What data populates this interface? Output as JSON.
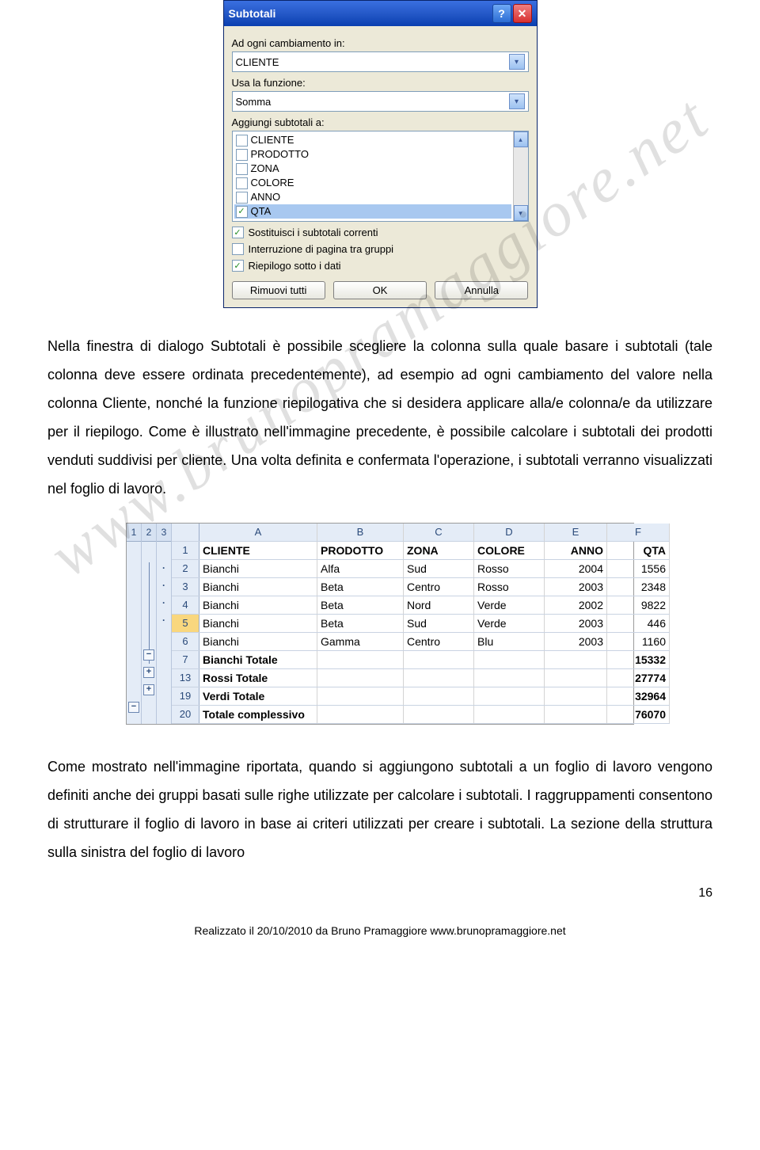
{
  "watermark": "www.brunopramaggiore.net",
  "dialog": {
    "title": "Subtotali",
    "label_change": "Ad ogni cambiamento in:",
    "select_change": "CLIENTE",
    "label_func": "Usa la funzione:",
    "select_func": "Somma",
    "label_add": "Aggiungi subtotali a:",
    "items": [
      {
        "label": "CLIENTE",
        "checked": false
      },
      {
        "label": "PRODOTTO",
        "checked": false
      },
      {
        "label": "ZONA",
        "checked": false
      },
      {
        "label": "COLORE",
        "checked": false
      },
      {
        "label": "ANNO",
        "checked": false
      },
      {
        "label": "QTA",
        "checked": true,
        "selected": true
      }
    ],
    "opt_replace": "Sostituisci i subtotali correnti",
    "opt_replace_checked": true,
    "opt_pagebreak": "Interruzione di pagina tra gruppi",
    "opt_pagebreak_checked": false,
    "opt_summary": "Riepilogo sotto i dati",
    "opt_summary_checked": true,
    "btn_remove": "Rimuovi tutti",
    "btn_ok": "OK",
    "btn_cancel": "Annulla"
  },
  "para1": "Nella finestra di dialogo Subtotali è possibile scegliere la colonna sulla quale basare i subtotali (tale colonna deve essere ordinata precedentemente), ad esempio ad ogni cambiamento del valore nella colonna Cliente, nonché la funzione riepilogativa che si desidera applicare alla/e colonna/e da utilizzare per il riepilogo. Come è illustrato nell'immagine precedente, è possibile calcolare i subtotali dei prodotti venduti suddivisi per cliente. Una volta definita e confermata l'operazione, i subtotali verranno visualizzati nel foglio di lavoro.",
  "sheet": {
    "outline_levels": [
      "1",
      "2",
      "3"
    ],
    "cols": [
      "A",
      "B",
      "C",
      "D",
      "E",
      "F"
    ],
    "rows": [
      {
        "n": "1",
        "bold": true,
        "c": [
          "CLIENTE",
          "PRODOTTO",
          "ZONA",
          "COLORE",
          "ANNO",
          "QTA"
        ]
      },
      {
        "n": "2",
        "c": [
          "Bianchi",
          "Alfa",
          "Sud",
          "Rosso",
          "2004",
          "1556"
        ]
      },
      {
        "n": "3",
        "c": [
          "Bianchi",
          "Beta",
          "Centro",
          "Rosso",
          "2003",
          "2348"
        ]
      },
      {
        "n": "4",
        "c": [
          "Bianchi",
          "Beta",
          "Nord",
          "Verde",
          "2002",
          "9822"
        ]
      },
      {
        "n": "5",
        "sel": true,
        "c": [
          "Bianchi",
          "Beta",
          "Sud",
          "Verde",
          "2003",
          "446"
        ]
      },
      {
        "n": "6",
        "c": [
          "Bianchi",
          "Gamma",
          "Centro",
          "Blu",
          "2003",
          "1160"
        ]
      },
      {
        "n": "7",
        "bold": true,
        "c": [
          "Bianchi Totale",
          "",
          "",
          "",
          "",
          "15332"
        ]
      },
      {
        "n": "13",
        "bold": true,
        "c": [
          "Rossi Totale",
          "",
          "",
          "",
          "",
          "27774"
        ]
      },
      {
        "n": "19",
        "bold": true,
        "c": [
          "Verdi Totale",
          "",
          "",
          "",
          "",
          "32964"
        ]
      },
      {
        "n": "20",
        "bold": true,
        "c": [
          "Totale complessivo",
          "",
          "",
          "",
          "",
          "76070"
        ]
      }
    ]
  },
  "para2": "Come mostrato nell'immagine riportata, quando si aggiungono subtotali a un foglio di lavoro vengono definiti anche dei gruppi basati sulle righe utilizzate per calcolare i subtotali. I raggruppamenti consentono di strutturare il foglio di lavoro in base ai criteri utilizzati per creare i subtotali. La sezione della struttura sulla sinistra del foglio di lavoro",
  "page_number": "16",
  "footer": "Realizzato il 20/10/2010 da Bruno Pramaggiore  www.brunopramaggiore.net"
}
